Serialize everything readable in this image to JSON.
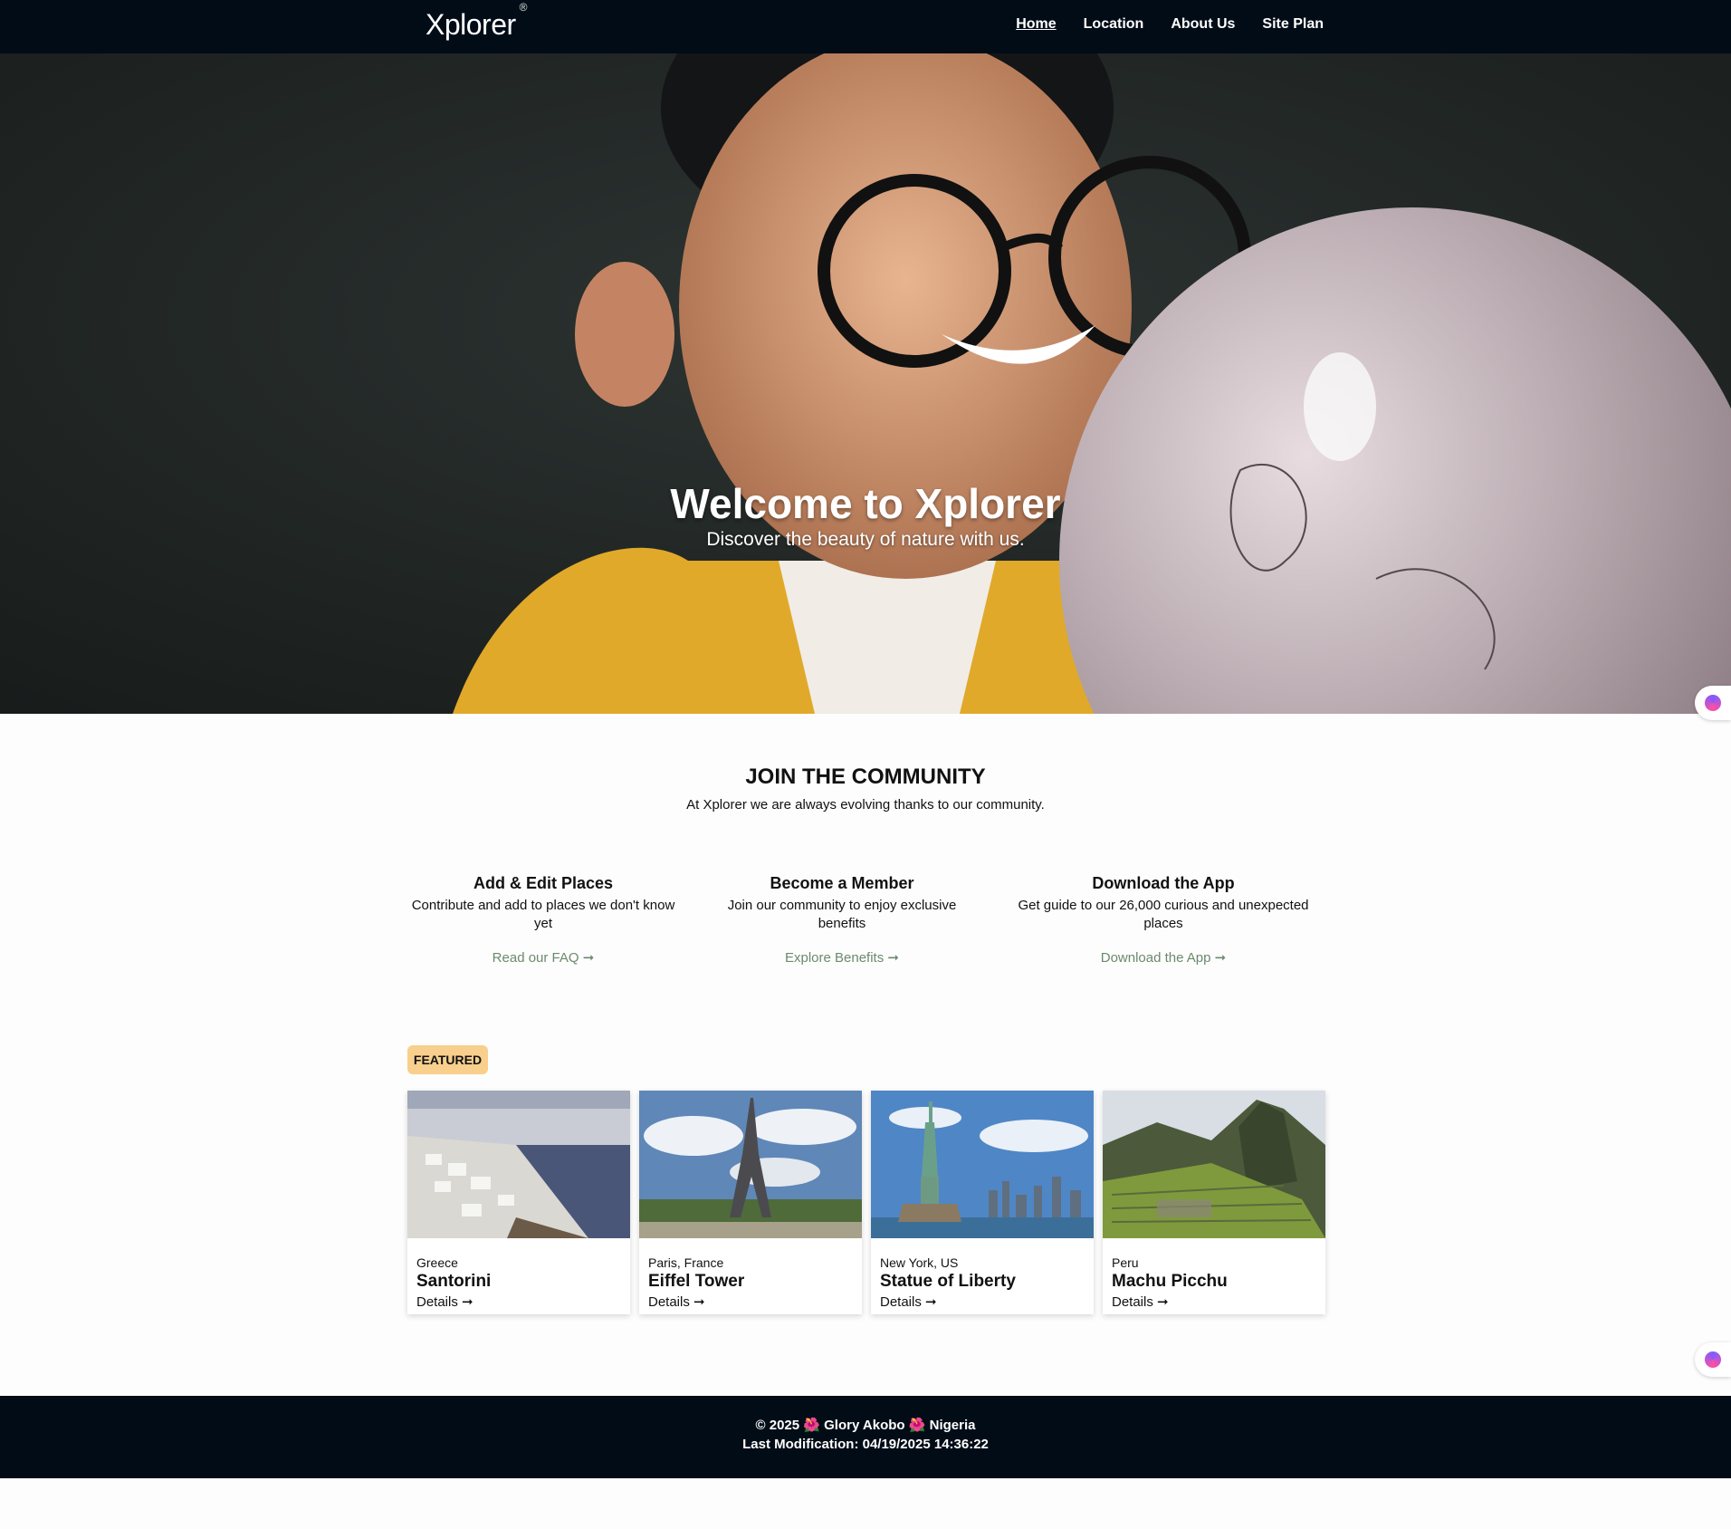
{
  "brand": {
    "name": "Xplorer",
    "mark": "®"
  },
  "nav": {
    "items": [
      {
        "label": "Home",
        "active": true
      },
      {
        "label": "Location",
        "active": false
      },
      {
        "label": "About Us",
        "active": false
      },
      {
        "label": "Site Plan",
        "active": false
      }
    ]
  },
  "hero": {
    "title": "Welcome to Xplorer",
    "subtitle": "Discover the beauty of nature with us."
  },
  "community": {
    "title": "JOIN THE COMMUNITY",
    "subtitle": "At Xplorer we are always evolving thanks to our community."
  },
  "features": [
    {
      "title": "Add & Edit Places",
      "text": "Contribute and add to places we don't know yet",
      "link": "Read our FAQ"
    },
    {
      "title": "Become a Member",
      "text": "Join our community to enjoy exclusive benefits",
      "link": "Explore Benefits"
    },
    {
      "title": "Download the App",
      "text": "Get guide to our 26,000 curious and unexpected places",
      "link": "Download the App"
    }
  ],
  "featured": {
    "badge": "FEATURED"
  },
  "cards": [
    {
      "location": "Greece",
      "name": "Santorini",
      "details": "Details"
    },
    {
      "location": "Paris, France",
      "name": "Eiffel Tower",
      "details": "Details"
    },
    {
      "location": "New York, US",
      "name": "Statue of Liberty",
      "details": "Details"
    },
    {
      "location": "Peru",
      "name": "Machu Picchu",
      "details": "Details"
    }
  ],
  "arrow": "➞",
  "footer": {
    "copyright": "© 2025",
    "author": "Glory Akobo",
    "country": "Nigeria",
    "flower": "🌺",
    "modified": "Last Modification: 04/19/2025 14:36:22"
  },
  "colors": {
    "navy": "#020c17",
    "badge": "#f8cf8c",
    "link": "#6b8a6e"
  }
}
